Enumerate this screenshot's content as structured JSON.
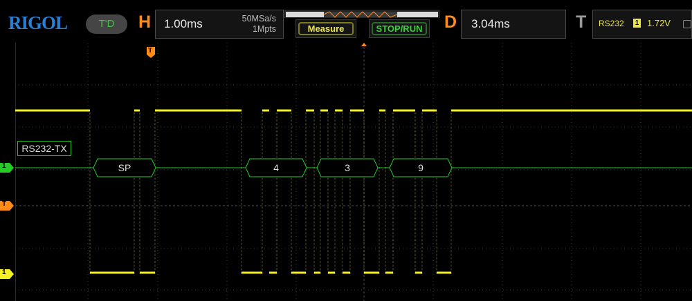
{
  "brand": {
    "logo": "RIGOL",
    "status": "T'D"
  },
  "horizontal": {
    "letter": "H",
    "timebase": "1.00ms",
    "sample_rate": "50MSa/s",
    "memory_depth": "1Mpts"
  },
  "buttons": {
    "measure": "Measure",
    "stop_run": "STOP/RUN"
  },
  "delay": {
    "letter": "D",
    "value": "3.04ms"
  },
  "trigger": {
    "letter": "T",
    "source": "RS232",
    "channel_badge": "1",
    "level": "1.72V"
  },
  "channel": {
    "label": "RS232-TX",
    "marker": "1"
  },
  "markers": {
    "trigger": "T",
    "ch1": "1"
  },
  "decode": {
    "packets": [
      "SP",
      "4",
      "3",
      "9"
    ]
  },
  "colors": {
    "accent": "#ff8c1a",
    "channel_yellow": "#f5f021",
    "decode_green": "#22cc22",
    "logo_blue": "#2a7fd6"
  }
}
